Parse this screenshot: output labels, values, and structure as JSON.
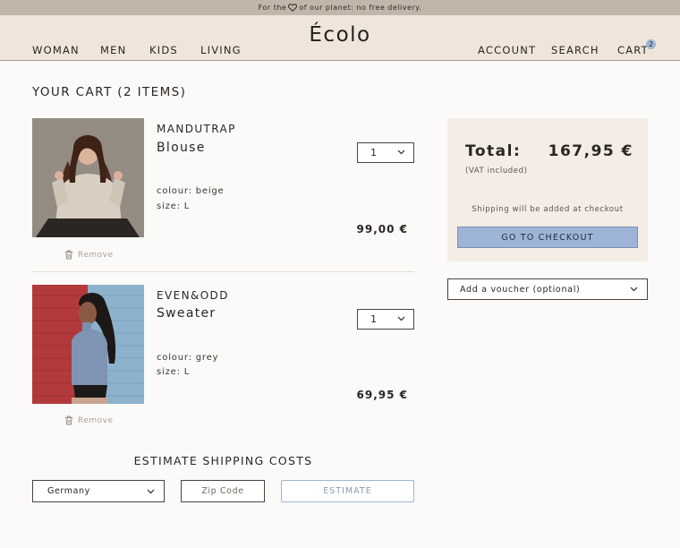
{
  "promo": {
    "before": "For the",
    "after": "of our planet: no free delivery."
  },
  "header": {
    "logo": "Écolo",
    "nav_left": [
      "WOMAN",
      "MEN",
      "KIDS",
      "LIVING"
    ],
    "nav_right": [
      "ACCOUNT",
      "SEARCH",
      "CART"
    ],
    "cart_count": "2"
  },
  "cart": {
    "title": "YOUR CART (2 ITEMS)",
    "items": [
      {
        "brand": "MANDUTRAP",
        "name": "Blouse",
        "colour": "colour: beige",
        "size": "size: L",
        "price": "99,00 €",
        "quantity": "1",
        "remove_label": "Remove"
      },
      {
        "brand": "EVEN&ODD",
        "name": "Sweater",
        "colour": "colour: grey",
        "size": "size: L",
        "price": "69,95 €",
        "quantity": "1",
        "remove_label": "Remove"
      }
    ]
  },
  "summary": {
    "total_label": "Total:",
    "total_value": "167,95 €",
    "vat_note": "(VAT included)",
    "shipping_note": "Shipping will be added at checkout",
    "checkout_label": "GO TO CHECKOUT",
    "voucher_label": "Add a voucher (optional)"
  },
  "shipping": {
    "title": "ESTIMATE SHIPPING COSTS",
    "country": "Germany",
    "zip_placeholder": "Zip Code",
    "estimate_label": "ESTIMATE"
  },
  "colors": {
    "promo_bg": "#c2b6aa",
    "header_bg": "#efe5db",
    "accent_blue": "#9eb4d6",
    "summary_bg": "#f3ede6"
  },
  "icons": [
    "heart-icon",
    "trash-icon",
    "chevron-down-icon"
  ]
}
